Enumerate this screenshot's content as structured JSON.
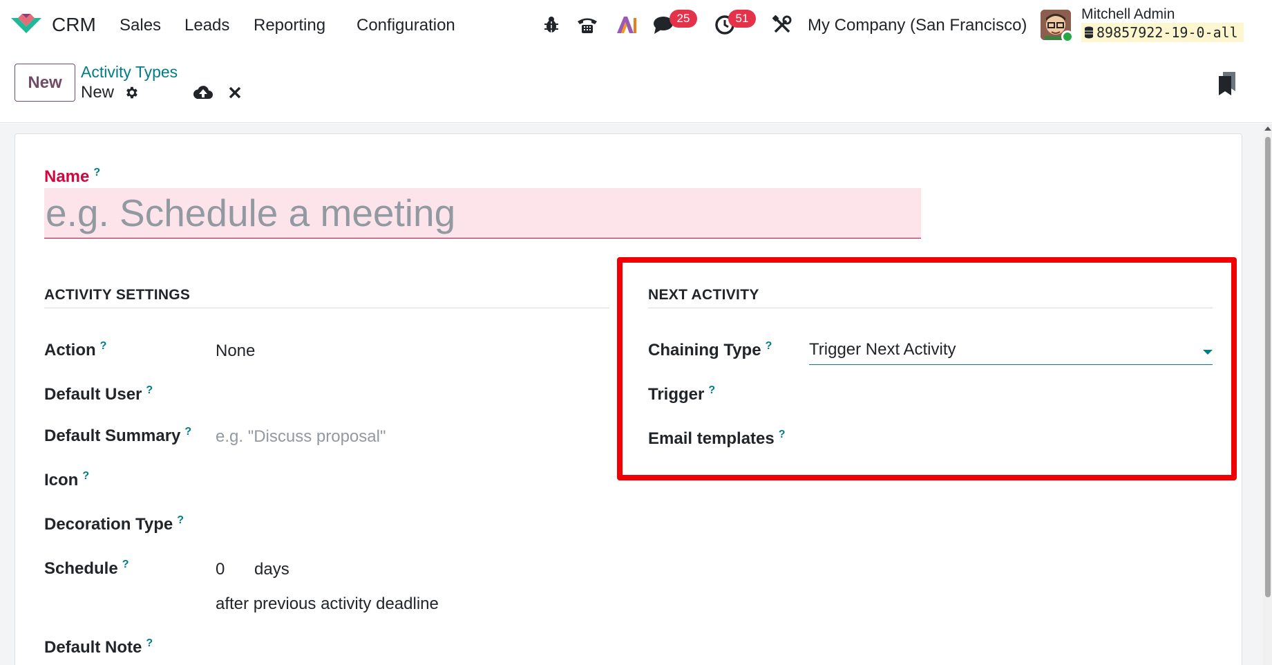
{
  "navbar": {
    "app_name": "CRM",
    "menus": [
      "Sales",
      "Leads",
      "Reporting",
      "Configuration"
    ],
    "messages_count": "25",
    "activities_count": "51",
    "company": "My Company (San Francisco)",
    "user_name": "Mitchell Admin",
    "database": "89857922-19-0-all",
    "icons": [
      "bug-icon",
      "phone-icon",
      "ai-icon",
      "chat-icon",
      "clock-icon",
      "tools-icon"
    ]
  },
  "control_panel": {
    "new_button": "New",
    "breadcrumb_parent": "Activity Types",
    "breadcrumb_current": "New"
  },
  "form": {
    "name_label": "Name",
    "name_placeholder": "e.g. Schedule a meeting",
    "help_mark": "?",
    "activity_settings": {
      "title": "ACTIVITY SETTINGS",
      "action_label": "Action",
      "action_value": "None",
      "default_user_label": "Default User",
      "default_summary_label": "Default Summary",
      "default_summary_placeholder": "e.g. \"Discuss proposal\"",
      "icon_label": "Icon",
      "decoration_type_label": "Decoration Type",
      "schedule_label": "Schedule",
      "schedule_value": "0",
      "schedule_unit": "days",
      "schedule_after": "after previous activity deadline",
      "default_note_label": "Default Note"
    },
    "next_activity": {
      "title": "NEXT ACTIVITY",
      "chaining_type_label": "Chaining Type",
      "chaining_type_value": "Trigger Next Activity",
      "trigger_label": "Trigger",
      "email_templates_label": "Email templates"
    }
  },
  "colors": {
    "brand": "#714b67",
    "link": "#017e84",
    "required": "#d10840",
    "badge": "#e3324a",
    "highlight": "#f00002"
  }
}
